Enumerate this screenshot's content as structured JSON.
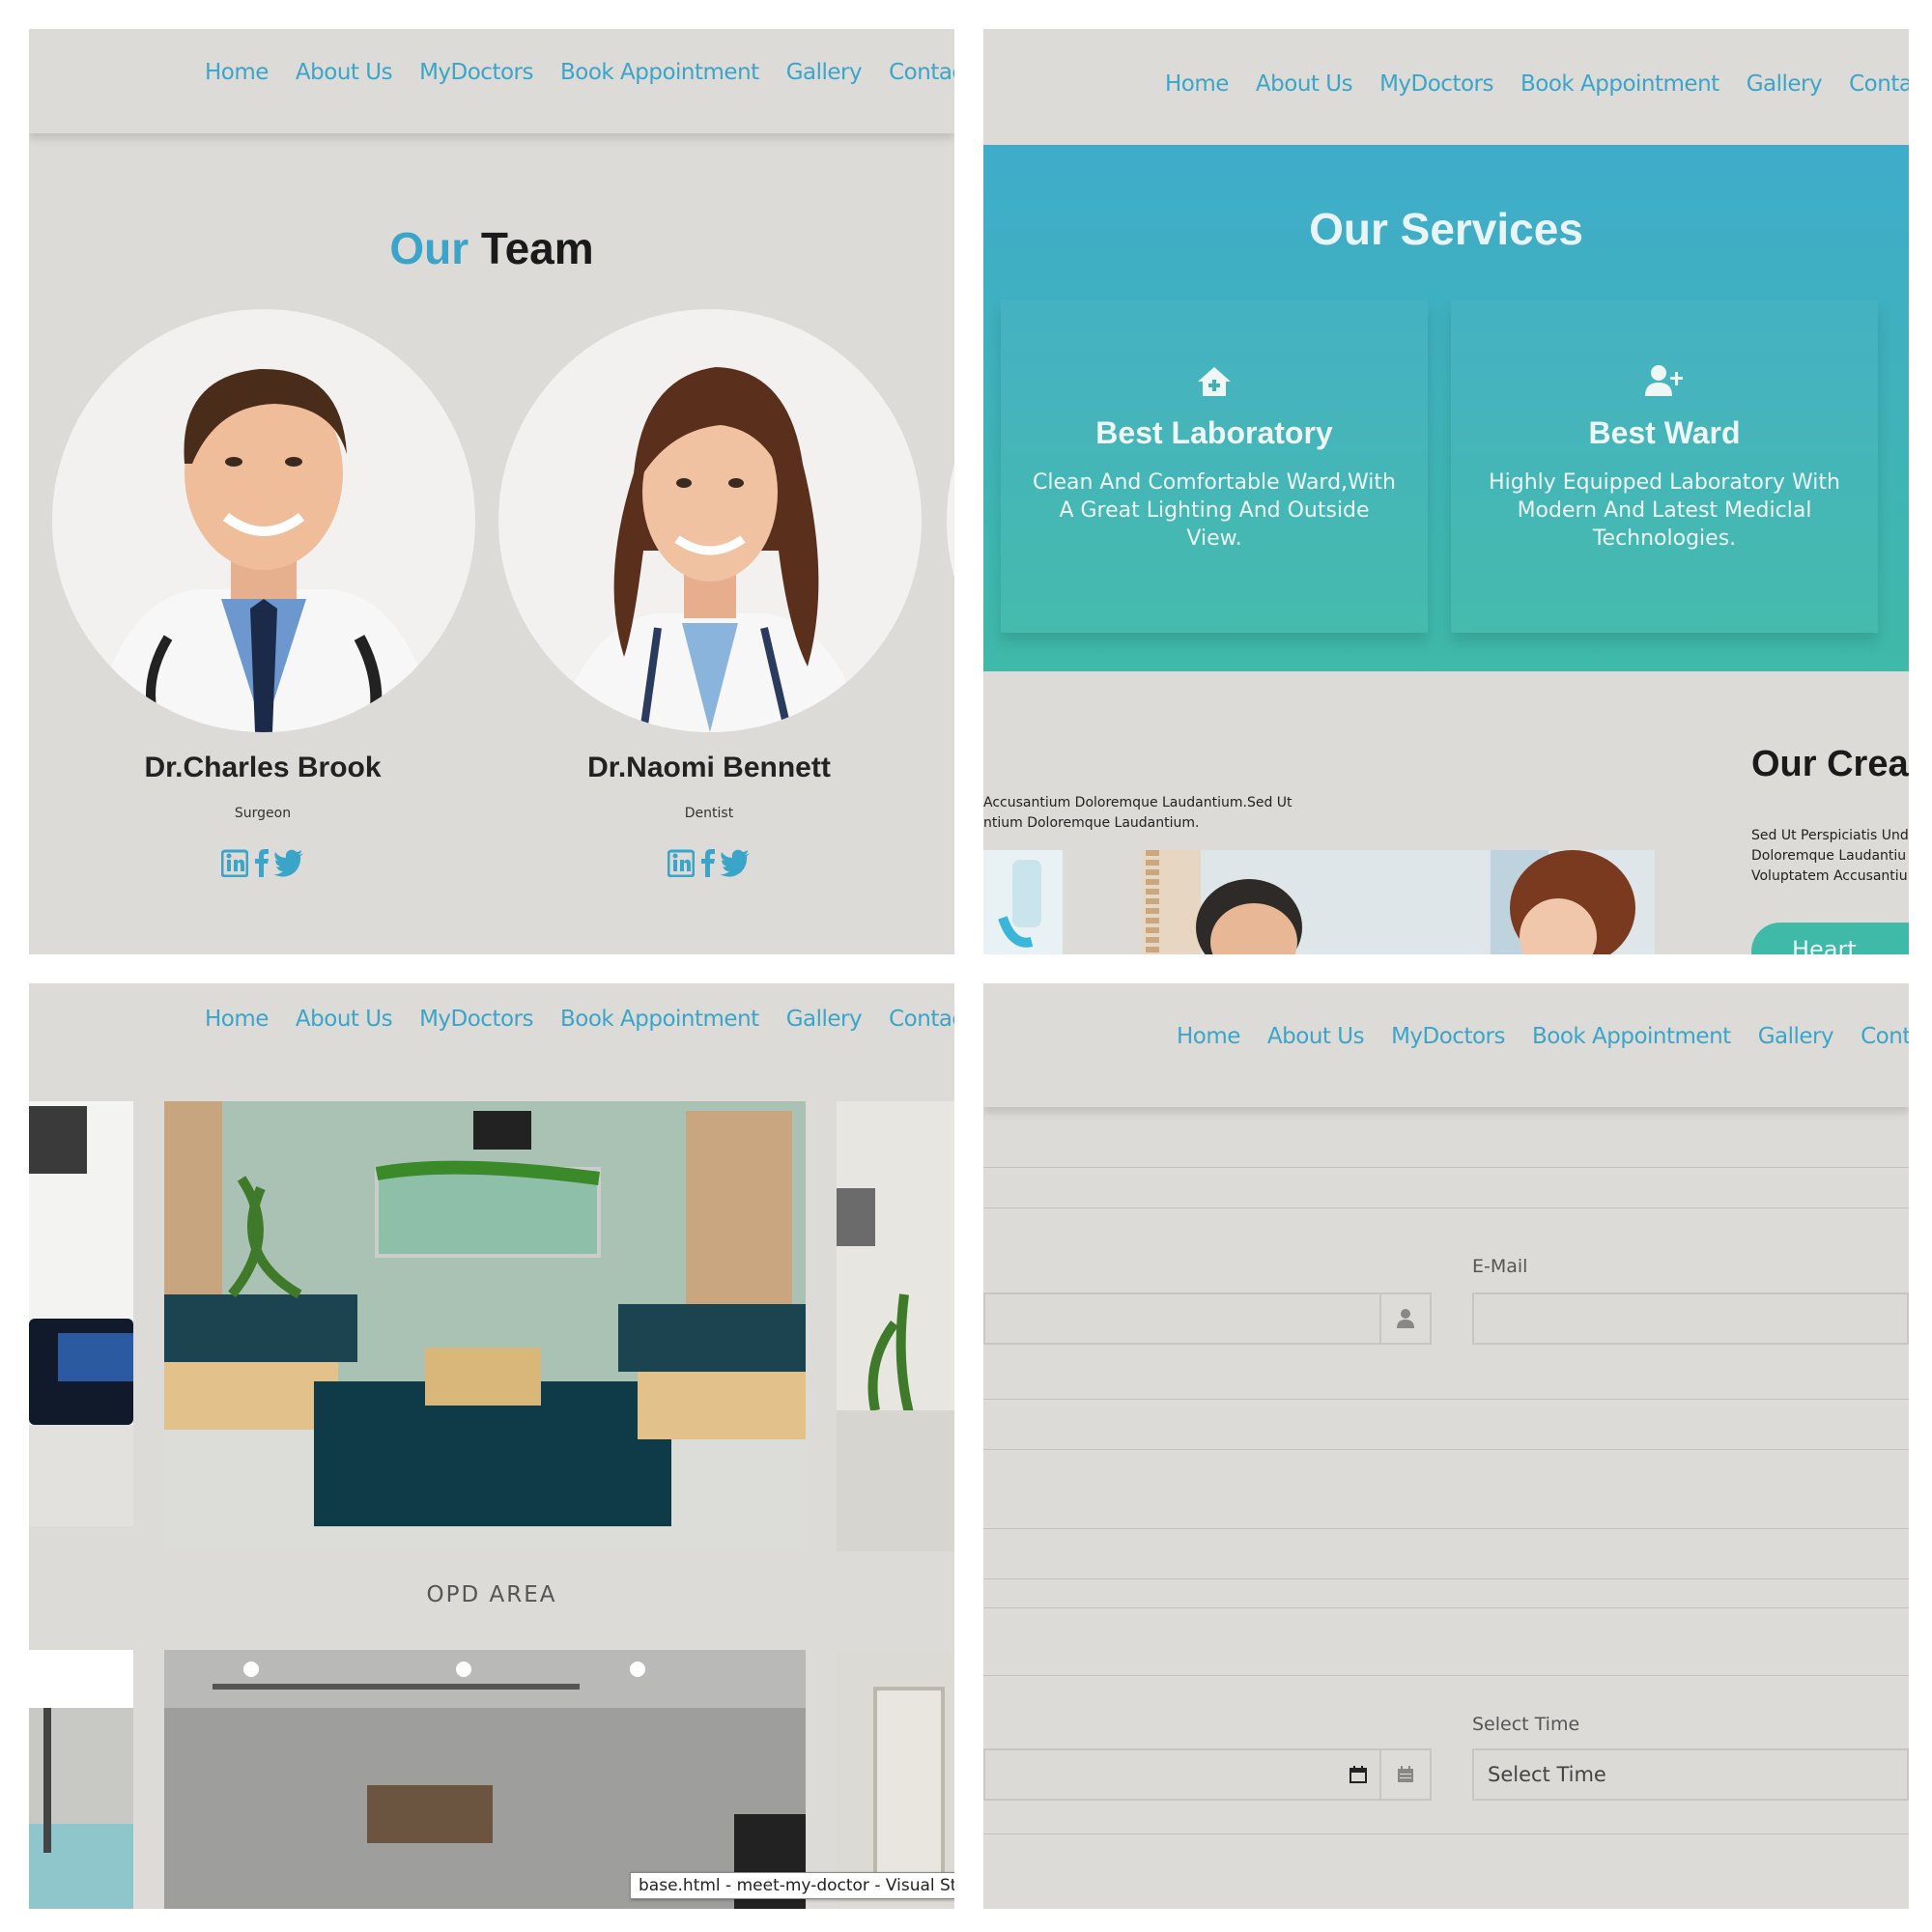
{
  "nav": [
    "Home",
    "About Us",
    "MyDoctors",
    "Book Appointment",
    "Gallery",
    "Contact"
  ],
  "nav_panel3_last": "Contact U",
  "team": {
    "title_accent": "Our",
    "title_rest": "Team",
    "doctors": [
      {
        "name": "Dr.Charles Brook",
        "role": "Surgeon"
      },
      {
        "name": "Dr.Naomi Bennett",
        "role": "Dentist"
      }
    ]
  },
  "services": {
    "title": "Our Services",
    "cards": [
      {
        "icon": "house-medical-icon",
        "title": "Best Laboratory",
        "desc": "Clean And Comfortable Ward,With A Great Lighting And Outside View."
      },
      {
        "icon": "user-plus-icon",
        "title": "Best Ward",
        "desc": "Highly Equipped Laboratory With Modern And Latest Mediclal Technologies."
      }
    ],
    "creative_title": "Our Creat",
    "left_text_1": "Accusantium Doloremque Laudantium.Sed Ut",
    "left_text_2": "ntium Doloremque Laudantium.",
    "right_text_1": "Sed Ut Perspiciatis Und",
    "right_text_2": "Doloremque Laudantiu",
    "right_text_3": "Voluptatem Accusantiu",
    "button_text": "Heart"
  },
  "gallery": {
    "caption": "OPD AREA",
    "tooltip": "base.html - meet-my-doctor - Visual Stu"
  },
  "form": {
    "email_label": "E-Mail",
    "time_label": "Select Time",
    "time_value": "Select Time"
  },
  "colors": {
    "accent": "#3aa5c8",
    "panel_bg": "#dddbd8",
    "services_top": "#3faccb",
    "services_bottom": "#3fb9a8"
  }
}
